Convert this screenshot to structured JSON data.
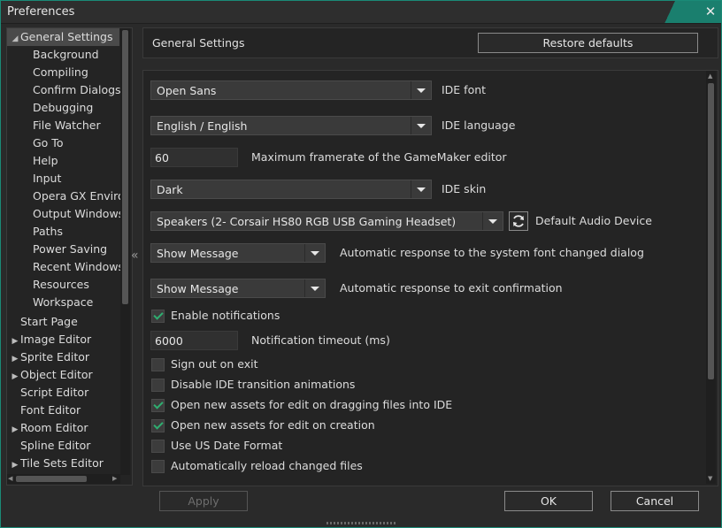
{
  "window": {
    "title": "Preferences",
    "close_glyph": "✕"
  },
  "sidebar": {
    "items": [
      {
        "label": "General Settings",
        "expanded": true,
        "selected": true
      },
      {
        "label": "Background"
      },
      {
        "label": "Compiling"
      },
      {
        "label": "Confirm Dialogs"
      },
      {
        "label": "Debugging"
      },
      {
        "label": "File Watcher"
      },
      {
        "label": "Go To"
      },
      {
        "label": "Help"
      },
      {
        "label": "Input"
      },
      {
        "label": "Opera GX Enviror"
      },
      {
        "label": "Output Windows"
      },
      {
        "label": "Paths"
      },
      {
        "label": "Power Saving"
      },
      {
        "label": "Recent Windows"
      },
      {
        "label": "Resources"
      },
      {
        "label": "Workspace"
      },
      {
        "label": "Start Page"
      },
      {
        "label": "Image Editor",
        "collapsed": true
      },
      {
        "label": "Sprite Editor",
        "collapsed": true
      },
      {
        "label": "Object Editor",
        "collapsed": true
      },
      {
        "label": "Script Editor"
      },
      {
        "label": "Font Editor"
      },
      {
        "label": "Room Editor",
        "collapsed": true
      },
      {
        "label": "Spline Editor"
      },
      {
        "label": "Tile Sets Editor",
        "collapsed": true
      }
    ],
    "collapse_glyph": "«"
  },
  "header": {
    "title": "General Settings",
    "restore_label": "Restore defaults"
  },
  "settings": {
    "ide_font": {
      "value": "Open Sans",
      "label": "IDE font"
    },
    "ide_language": {
      "value": "English / English",
      "label": "IDE language"
    },
    "framerate": {
      "value": "60",
      "label": "Maximum framerate of the GameMaker editor"
    },
    "ide_skin": {
      "value": "Dark",
      "label": "IDE skin"
    },
    "audio_device": {
      "value": "Speakers (2- Corsair HS80 RGB USB Gaming Headset)",
      "label": "Default Audio Device"
    },
    "font_changed_response": {
      "value": "Show Message",
      "label": "Automatic response to the system font changed dialog"
    },
    "exit_response": {
      "value": "Show Message",
      "label": "Automatic response to exit confirmation"
    },
    "notification_timeout": {
      "value": "6000",
      "label": "Notification timeout (ms)"
    },
    "checkboxes": [
      {
        "label": "Enable notifications",
        "checked": true
      },
      {
        "label": "Sign out on exit",
        "checked": false
      },
      {
        "label": "Disable IDE transition animations",
        "checked": false
      },
      {
        "label": "Open new assets for edit on dragging files into IDE",
        "checked": true
      },
      {
        "label": "Open new assets for edit on creation",
        "checked": true
      },
      {
        "label": "Use US Date Format",
        "checked": false
      },
      {
        "label": "Automatically reload changed files",
        "checked": false
      }
    ]
  },
  "footer": {
    "apply_label": "Apply",
    "ok_label": "OK",
    "cancel_label": "Cancel"
  },
  "colors": {
    "accent": "#1a7f6e",
    "check": "#2fae70",
    "background": "#2a2a2a"
  }
}
